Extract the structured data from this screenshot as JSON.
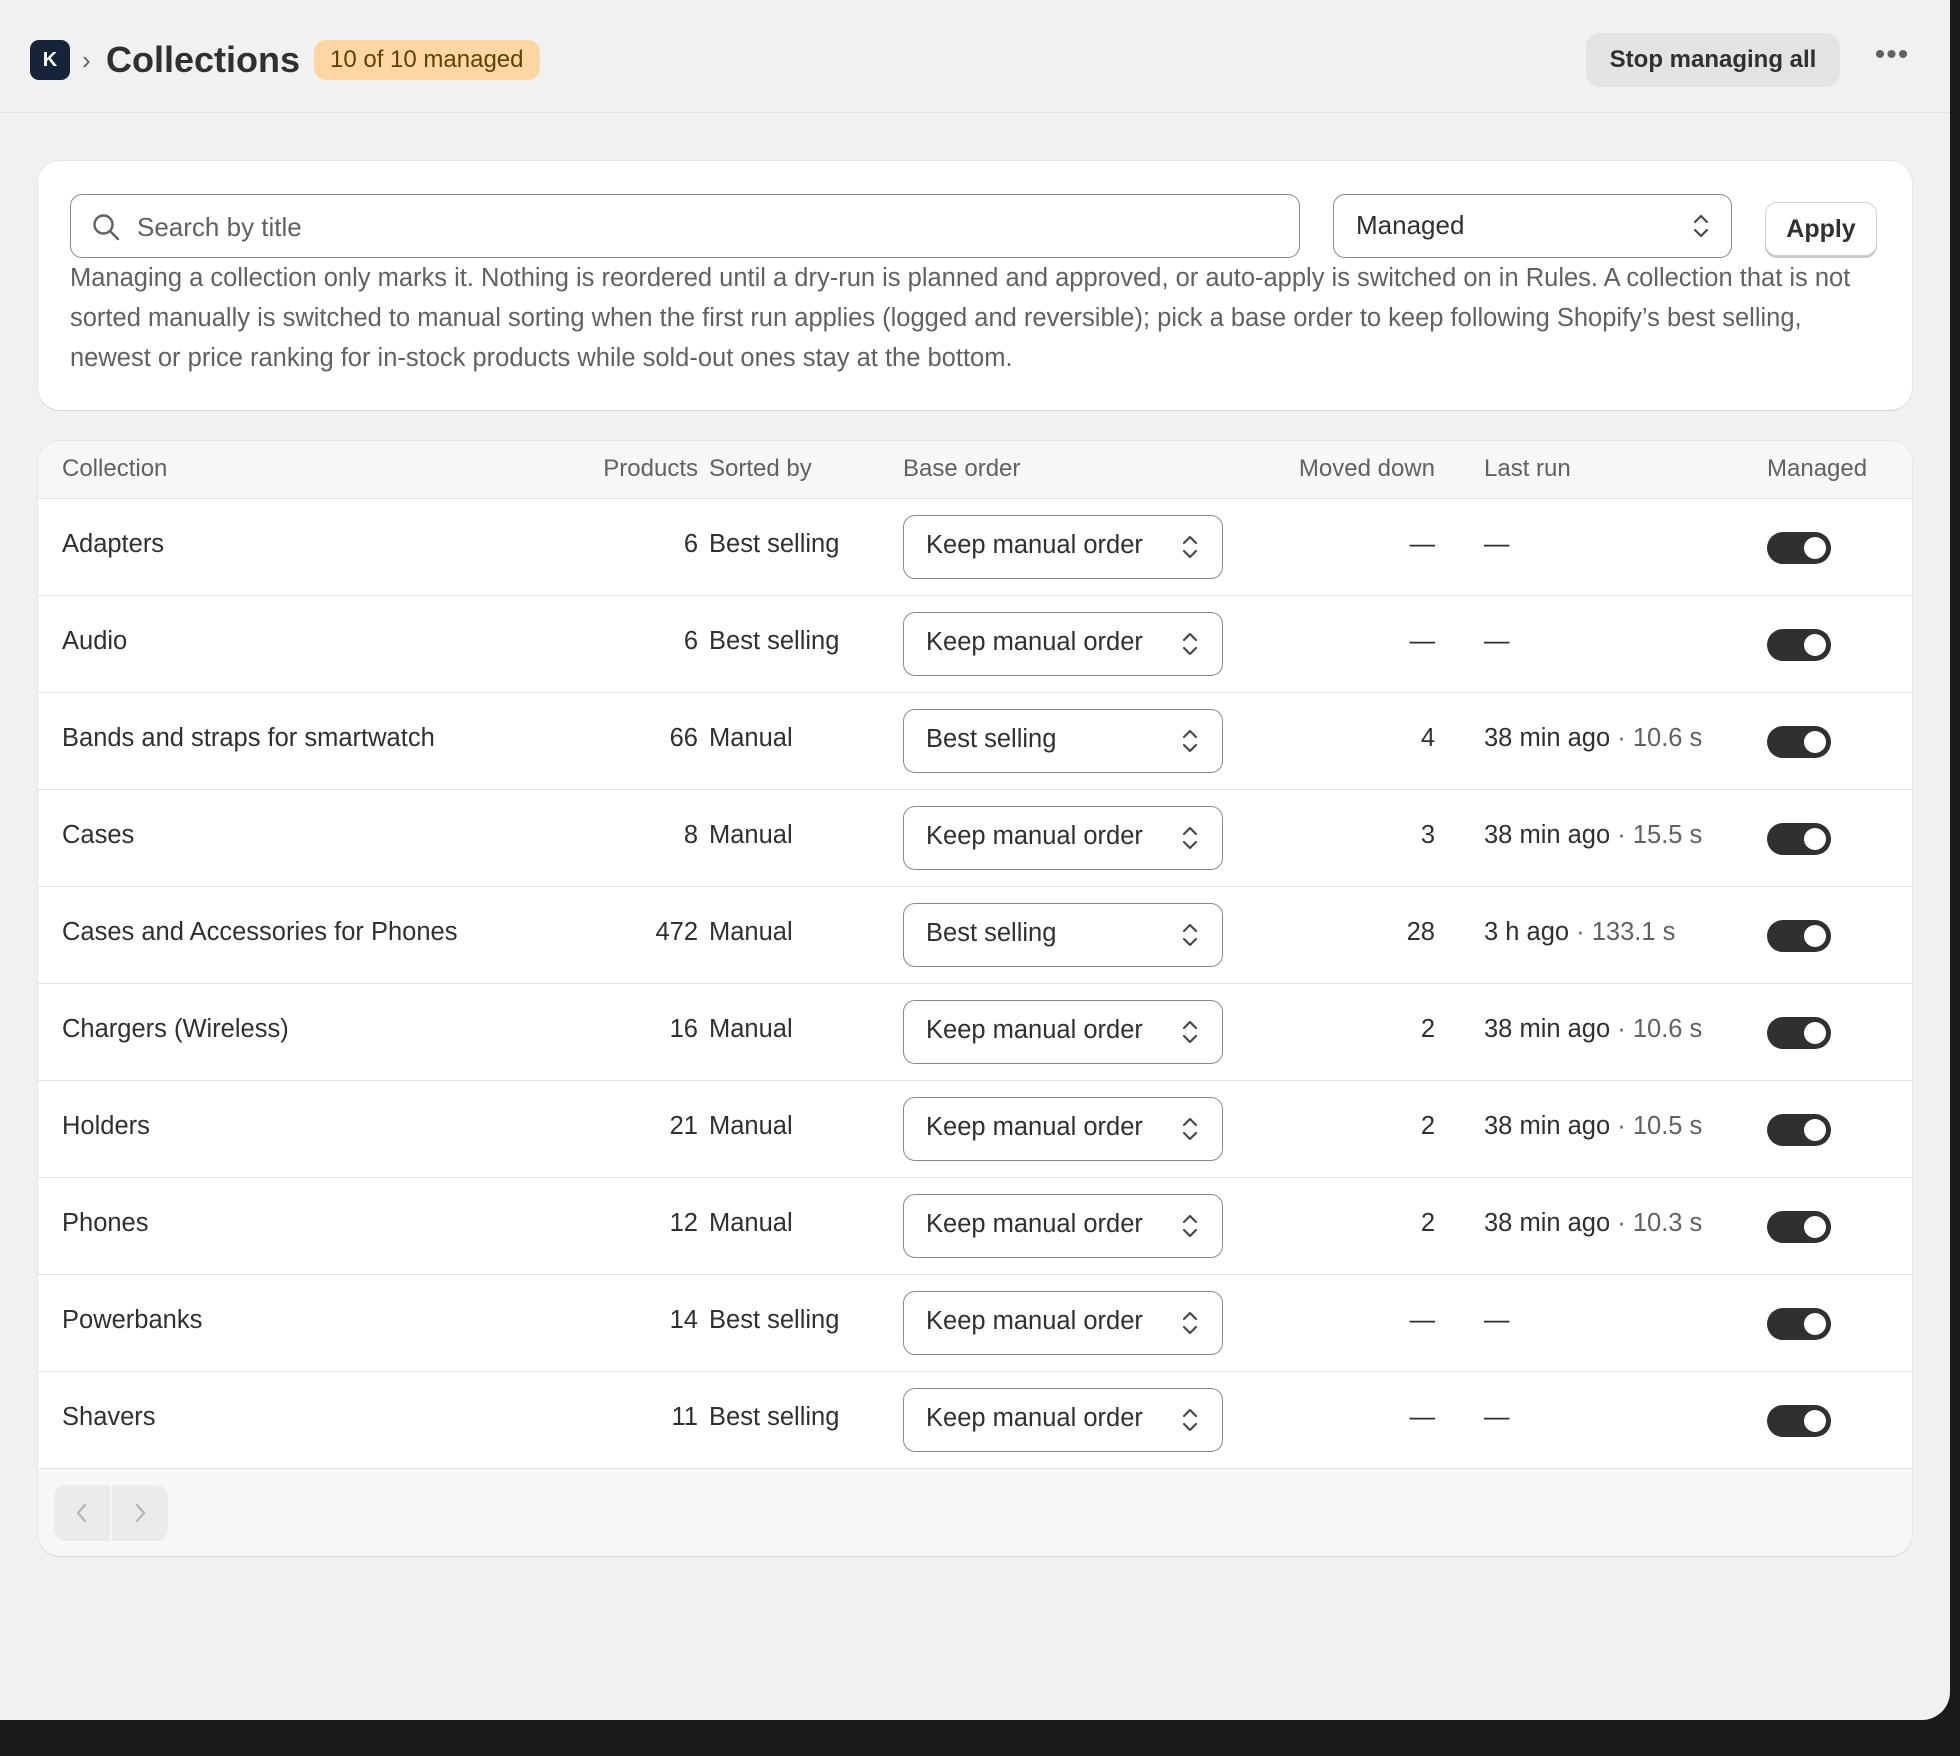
{
  "header": {
    "app_logo_letter": "K",
    "breadcrumb_separator": "›",
    "title": "Collections",
    "badge": "10 of 10 managed",
    "stop_button": "Stop managing all",
    "more_button": "•••"
  },
  "filters": {
    "search_placeholder": "Search by title",
    "search_value": "",
    "status_selected": "Managed",
    "apply_button": "Apply",
    "help_text": "Managing a collection only marks it. Nothing is reordered until a dry-run is planned and approved, or auto-apply is switched on in Rules. A collection that is not sorted manually is switched to manual sorting when the first run applies (logged and reversible); pick a base order to keep following Shopify’s best selling, newest or price ranking for in-stock products while sold-out ones stay at the bottom."
  },
  "table": {
    "headers": {
      "collection": "Collection",
      "products": "Products",
      "sorted_by": "Sorted by",
      "base_order": "Base order",
      "moved_down": "Moved down",
      "last_run": "Last run",
      "managed": "Managed"
    },
    "rows": [
      {
        "collection": "Adapters",
        "products": "6",
        "sorted_by": "Best selling",
        "base_order": "Keep manual order",
        "moved_down": "—",
        "last_run": "—",
        "last_run_duration": "",
        "managed": true
      },
      {
        "collection": "Audio",
        "products": "6",
        "sorted_by": "Best selling",
        "base_order": "Keep manual order",
        "moved_down": "—",
        "last_run": "—",
        "last_run_duration": "",
        "managed": true
      },
      {
        "collection": "Bands and straps for smartwatch",
        "products": "66",
        "sorted_by": "Manual",
        "base_order": "Best selling",
        "moved_down": "4",
        "last_run": "38 min ago",
        "last_run_duration": " · 10.6 s",
        "managed": true
      },
      {
        "collection": "Cases",
        "products": "8",
        "sorted_by": "Manual",
        "base_order": "Keep manual order",
        "moved_down": "3",
        "last_run": "38 min ago",
        "last_run_duration": " · 15.5 s",
        "managed": true
      },
      {
        "collection": "Cases and Accessories for Phones",
        "products": "472",
        "sorted_by": "Manual",
        "base_order": "Best selling",
        "moved_down": "28",
        "last_run": "3 h ago",
        "last_run_duration": " · 133.1 s",
        "managed": true
      },
      {
        "collection": "Chargers (Wireless)",
        "products": "16",
        "sorted_by": "Manual",
        "base_order": "Keep manual order",
        "moved_down": "2",
        "last_run": "38 min ago",
        "last_run_duration": " · 10.6 s",
        "managed": true
      },
      {
        "collection": "Holders",
        "products": "21",
        "sorted_by": "Manual",
        "base_order": "Keep manual order",
        "moved_down": "2",
        "last_run": "38 min ago",
        "last_run_duration": " · 10.5 s",
        "managed": true
      },
      {
        "collection": "Phones",
        "products": "12",
        "sorted_by": "Manual",
        "base_order": "Keep manual order",
        "moved_down": "2",
        "last_run": "38 min ago",
        "last_run_duration": " · 10.3 s",
        "managed": true
      },
      {
        "collection": "Powerbanks",
        "products": "14",
        "sorted_by": "Best selling",
        "base_order": "Keep manual order",
        "moved_down": "—",
        "last_run": "—",
        "last_run_duration": "",
        "managed": true
      },
      {
        "collection": "Shavers",
        "products": "11",
        "sorted_by": "Best selling",
        "base_order": "Keep manual order",
        "moved_down": "—",
        "last_run": "—",
        "last_run_duration": "",
        "managed": true
      }
    ]
  },
  "pagination": {
    "prev_icon": "chevron-left-icon",
    "next_icon": "chevron-right-icon"
  },
  "colors": {
    "badge_bg": "#ffd6a4",
    "badge_text": "#5e4200",
    "toggle_on": "#303030",
    "logo_bg": "#152438",
    "page_bg": "#f1f1f1"
  }
}
